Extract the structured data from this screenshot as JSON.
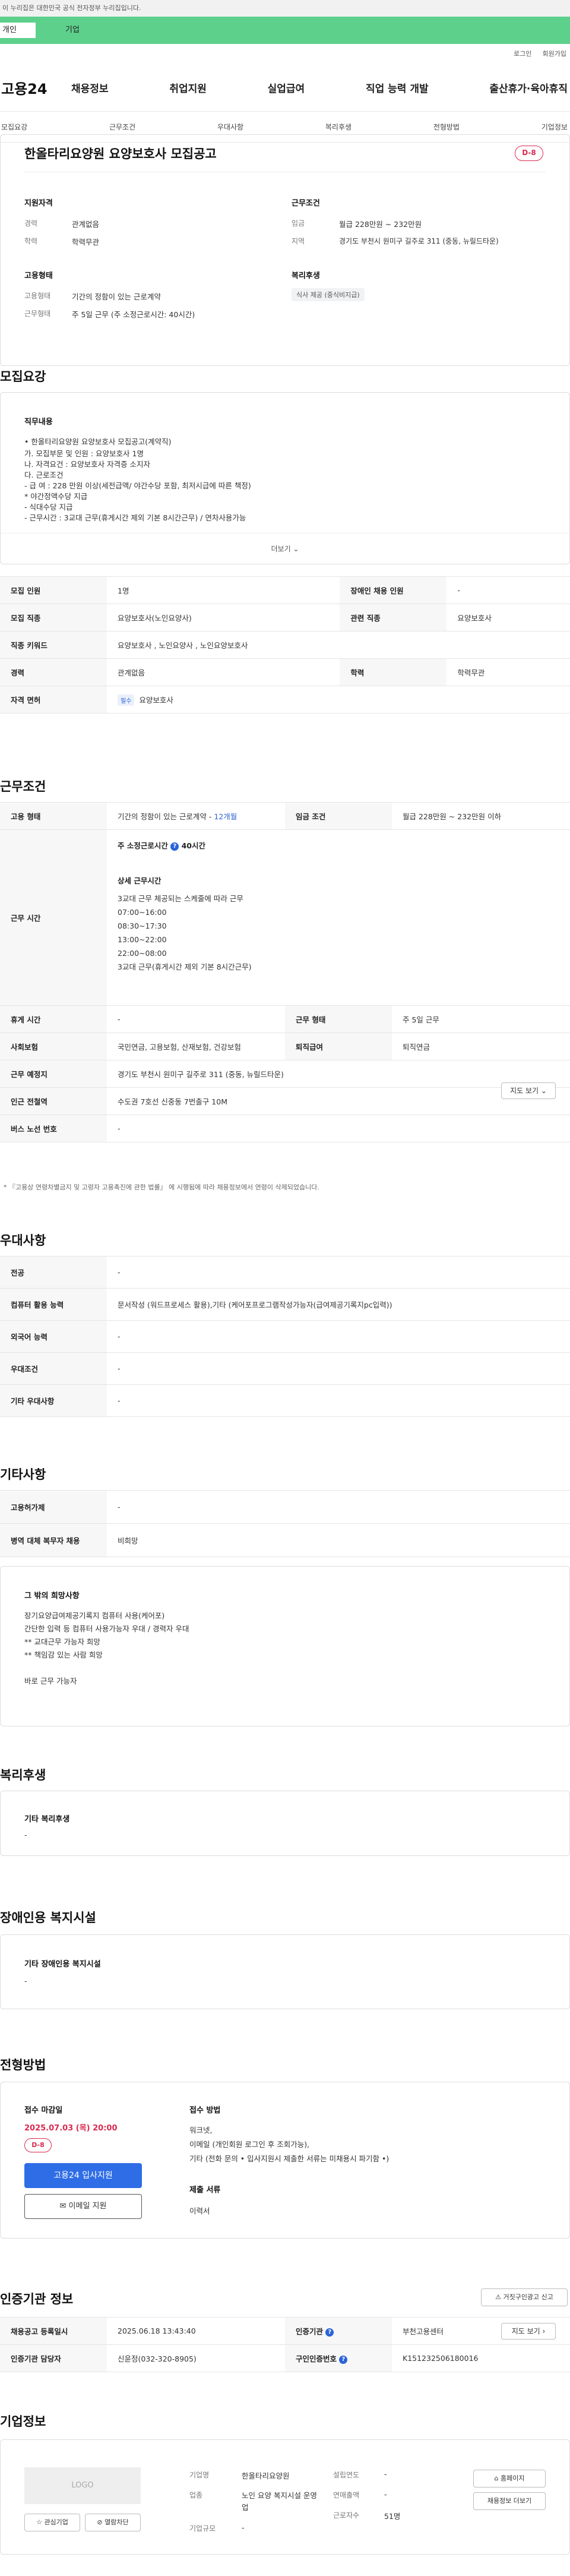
{
  "top": {
    "gov_notice": "이 누리집은 대한민국 공식 전자정부 누리집입니다.",
    "tab_personal": "개인",
    "tab_company": "기업",
    "login": "로그인",
    "signup": "회원가입"
  },
  "gnb": {
    "logo": "고용24",
    "items": [
      "채용정보",
      "취업지원",
      "실업급여",
      "직업 능력 개발",
      "출산휴가·육아휴직"
    ]
  },
  "subnav": [
    "모집요강",
    "근무조건",
    "우대사항",
    "복리후생",
    "전형방법",
    "기업정보"
  ],
  "summary": {
    "title": "한올타리요양원 요양보호사 모집공고",
    "dday": "D-8",
    "qual_heading": "지원자격",
    "career_key": "경력",
    "career_val": "관계없음",
    "edu_key": "학력",
    "edu_val": "학력무관",
    "emp_heading": "고용형태",
    "emp_type_key": "고용형태",
    "emp_type_val": "기간의 정함이 있는 근로계약",
    "worktype_key": "근무형태",
    "worktype_val": "주 5일 근무 (주 소정근로시간: 40시간)",
    "cond_heading": "근무조건",
    "wage_key": "임금",
    "wage_val": "월급 228만원 ~ 232만원",
    "region_key": "지역",
    "region_val": "경기도 부천시 원미구 길주로 311 (중동, 뉴릴드타운)",
    "welfare_heading": "복리후생",
    "welfare_tag": "식사 제공 (중식비지급)"
  },
  "recruit": {
    "section_title": "모집요강",
    "job_heading": "직무내용",
    "lines": [
      "• 한올타리요양원 요양보호사 모집공고(계약직)",
      "가. 모집부문 및 인원 : 요양보호사 1명",
      "나. 자격요건 : 요양보호사 자격증 소지자",
      "다. 근로조건",
      "- 급 여 : 228 만원 이상(세전급액/ 야간수당 포함, 최저시급에 따른 책정)",
      "          * 야간정액수당 지급",
      "- 식대수당 지급",
      "- 근무시간 : 3교대 근무(휴게시간 제외 기본 8시간근무) / 연차사용가능"
    ],
    "more": "더보기",
    "rows": [
      {
        "k1": "모집 인원",
        "v1": "1명",
        "k2": "장애인 채용 인원",
        "v2": "-"
      },
      {
        "k1": "모집 직종",
        "v1": "요양보호사(노인요양사)",
        "k2": "관련 직종",
        "v2": "요양보호사"
      },
      {
        "k1": "직종 키워드",
        "v1": "요양보호사 , 노인요양사 , 노인요양보호사",
        "k2": "",
        "v2": ""
      },
      {
        "k1": "경력",
        "v1": "관계없음",
        "k2": "학력",
        "v2": "학력무관"
      }
    ],
    "license_key": "자격 면허",
    "license_badge": "필수",
    "license_val": "요양보호사"
  },
  "conditions": {
    "section_title": "근무조건",
    "emp_key": "고용 형태",
    "emp_val": "기간의 정함이 있는 근로계약 - ",
    "emp_months": "12개월",
    "wage_key": "임금 조건",
    "wage_val": "월급 228만원 ~ 232만원 이하",
    "hours_key": "근무 시간",
    "hours_title": "주 소정근로시간",
    "hours_total": "40시간",
    "hours_detail_heading": "상세 근무시간",
    "hours_lines": [
      "3교대 근무 체공되는 스케줄에 따라 근무",
      "07:00~16:00",
      "08:30~17:30",
      "13:00~22:00",
      "22:00~08:00",
      "3교대 근무(휴게시간 제외 기본 8시간근무)"
    ],
    "break_key": "휴게 시간",
    "break_val": "-",
    "worktype_key": "근무 형태",
    "worktype_val": "주 5일 근무",
    "insurance_key": "사회보험",
    "insurance_val": "국민연금, 고용보험, 산재보험, 건강보험",
    "severance_key": "퇴직급여",
    "severance_val": "퇴직연금",
    "place_key": "근무 예정지",
    "place_val": "경기도 부천시 원미구 길주로 311 (중동, 뉴릴드타운)",
    "map_btn": "지도 보기",
    "subway_key": "인근 전철역",
    "subway_val": "수도권 7호선 신중동 7번출구 10M",
    "bus_key": "버스 노선 번호",
    "bus_val": "-",
    "footnote": "* 『고용상 연령차별금지 및 고령자 고용촉진에 관한 법률』 에 시행됨에 따라 채용정보에서 연령이 삭제되었습니다."
  },
  "preference": {
    "section_title": "우대사항",
    "rows": [
      {
        "k": "전공",
        "v": "-"
      },
      {
        "k": "컴퓨터 활용 능력",
        "v": "문서작성 (워드프로세스 활용),기타 (케어포프로그램작성가능자(급여제공기록지pc입력))"
      },
      {
        "k": "외국어 능력",
        "v": "-"
      },
      {
        "k": "우대조건",
        "v": "-"
      },
      {
        "k": "기타 우대사항",
        "v": "-"
      }
    ]
  },
  "etc": {
    "section_title": "기타사항",
    "rows": [
      {
        "k": "고용허가제",
        "v": "-"
      },
      {
        "k": "병역 대체 복무자 채용",
        "v": "비희망"
      }
    ],
    "box_heading": "그 밖의 희망사항",
    "box_lines": [
      "장기요양급여제공기록지 컴퓨터 사용(케어포)",
      "간단한 입력 등 컴퓨터 사용가능자 우대 / 경력자 우대",
      "** 교대근무 가능자 희망",
      "** 책임감 있는 사람 희망",
      "",
      "바로 근무 가능자"
    ]
  },
  "welfare": {
    "section_title": "복리후생",
    "heading": "기타 복리후생",
    "value": "-"
  },
  "disability": {
    "section_title": "장애인용 복지시설",
    "heading": "기타 장애인용 복지시설",
    "value": "-"
  },
  "process": {
    "section_title": "전형방법",
    "deadline_label": "접수 마감일",
    "deadline": "2025.07.03 (목) 20:00",
    "dday": "D-8",
    "apply_btn": "고용24 입사지원",
    "email_btn": "이메일 지원",
    "method_heading": "접수 방법",
    "method_lines": [
      "워크넷,",
      "이메일 (개인회원 로그인 후 조회가능),",
      "기타 (전화 문의 • 입사지원시 제출한 서류는 미채용시 파기함 •)"
    ],
    "docs_heading": "제출 서류",
    "docs_val": "이력서"
  },
  "agency": {
    "section_title": "인증기관 정보",
    "report_btn": "거짓구인광고 신고",
    "reg_date_key": "채용공고 등록일시",
    "reg_date_val": "2025.06.18 13:43:40",
    "agency_key": "인증기관",
    "agency_val": "부천고용센터",
    "map_btn": "지도 보기",
    "manager_key": "인증기관 담당자",
    "manager_val": "신윤정(032-320-8905)",
    "notice_no_key": "구인인증번호",
    "notice_no_val": "K151232506180016"
  },
  "company": {
    "section_title": "기업정보",
    "logo": "LOGO",
    "interest_btn": "관심기업",
    "block_btn": "열람차단",
    "name_key": "기업명",
    "name_val": "한올타리요양원",
    "industry_key": "업종",
    "industry_val": "노인 요양 복지시설 운영업",
    "scale_key": "기업규모",
    "scale_val": "-",
    "founded_key": "설립연도",
    "founded_val": "-",
    "sales_key": "연매출액",
    "sales_val": "-",
    "staff_key": "근로자수",
    "staff_val": "51명",
    "homepage_btn": "홈페이지",
    "more_jobs_btn": "채용정보 더보기"
  }
}
